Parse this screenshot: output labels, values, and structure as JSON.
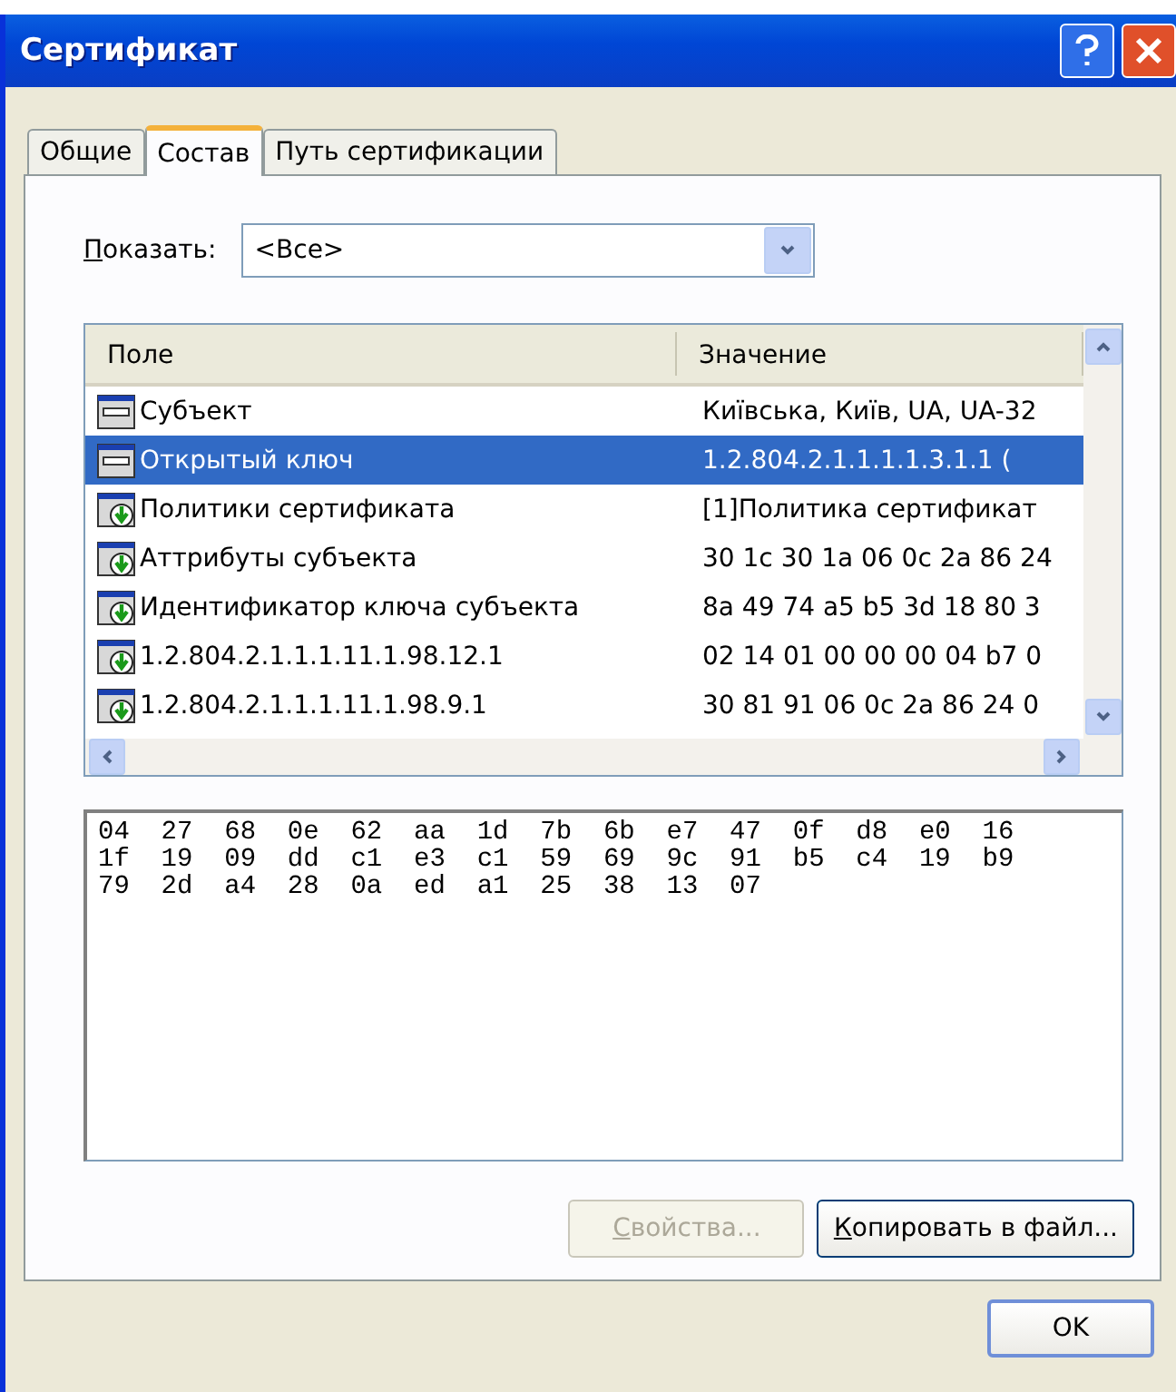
{
  "window": {
    "title": "Сертификат"
  },
  "tabs": [
    {
      "label": "Общие",
      "selected": false
    },
    {
      "label": "Состав",
      "selected": true
    },
    {
      "label": "Путь сертификации",
      "selected": false
    }
  ],
  "show": {
    "label": "Показать:",
    "value": "<Все>"
  },
  "table": {
    "columns": [
      "Поле",
      "Значение"
    ],
    "rows": [
      {
        "kind": "plain",
        "field": "Субъект",
        "value": "Київська, Київ, UA, UA-32",
        "selected": false
      },
      {
        "kind": "plain",
        "field": "Открытый ключ",
        "value": "1.2.804.2.1.1.1.1.3.1.1 (",
        "selected": true
      },
      {
        "kind": "extension",
        "field": "Политики сертификата",
        "value": "[1]Политика сертификат",
        "selected": false
      },
      {
        "kind": "extension",
        "field": "Аттрибуты субъекта",
        "value": "30 1c 30 1a 06 0c 2a 86 24",
        "selected": false
      },
      {
        "kind": "extension",
        "field": "Идентификатор ключа субъекта",
        "value": "8a 49 74 a5 b5 3d 18 80 3",
        "selected": false
      },
      {
        "kind": "extension",
        "field": "1.2.804.2.1.1.1.11.1.98.12.1",
        "value": "02 14 01 00 00 00 04 b7 0",
        "selected": false
      },
      {
        "kind": "extension",
        "field": "1.2.804.2.1.1.1.11.1.98.9.1",
        "value": "30 81 91 06 0c 2a 86 24 0",
        "selected": false
      }
    ]
  },
  "details": [
    "04 27 68 0e 62 aa 1d 7b 6b e7 47 0f d8 e0 16",
    "1f 19 09 dd c1 e3 c1 59 69 9c 91 b5 c4 19 b9",
    "79 2d a4 28 0a ed a1 25 38 13 07"
  ],
  "buttons": [
    {
      "label": "Свойства...",
      "disabled": true
    },
    {
      "label": "Копировать в файл...",
      "disabled": false
    }
  ],
  "ok": "OK"
}
